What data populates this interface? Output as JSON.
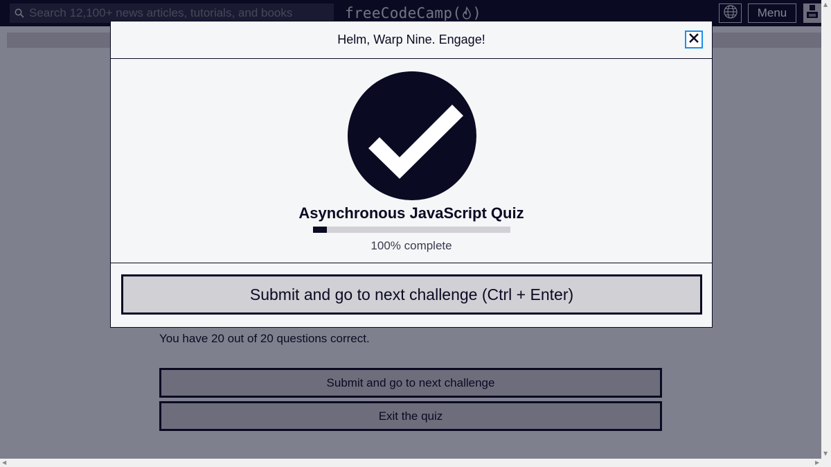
{
  "navbar": {
    "search_placeholder": "Search 12,100+ news articles, tutorials, and books",
    "brand_prefix": "freeCodeCamp(",
    "brand_suffix": ")",
    "menu_label": "Menu",
    "icons": {
      "search": "search-icon",
      "flame": "flame-icon",
      "globe": "globe-icon",
      "avatar": "avatar-icon"
    }
  },
  "page": {
    "result_text": "You have 20 out of 20 questions correct.",
    "submit_label": "Submit and go to next challenge",
    "exit_label": "Exit the quiz"
  },
  "modal": {
    "title": "Helm, Warp Nine. Engage!",
    "quiz_title": "Asynchronous JavaScript Quiz",
    "progress_percent": 7,
    "progress_text": "100% complete",
    "submit_label": "Submit and go to next challenge (Ctrl + Enter)",
    "icons": {
      "close": "close-icon",
      "success": "checkmark-icon"
    }
  },
  "colors": {
    "nav_bg": "#0a0a23",
    "search_bg": "#2a2a40",
    "button_bg": "#d0d0d5",
    "modal_bg": "#f5f6f7",
    "focus_ring": "#198eee"
  }
}
